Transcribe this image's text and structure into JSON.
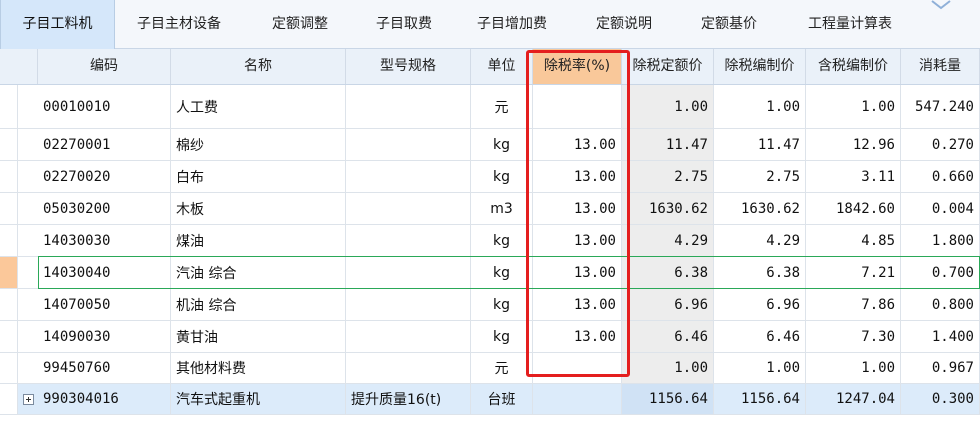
{
  "tabs": [
    {
      "label": "子目工料机",
      "active": true
    },
    {
      "label": "子目主材设备",
      "active": false
    },
    {
      "label": "定额调整",
      "active": false
    },
    {
      "label": "子目取费",
      "active": false
    },
    {
      "label": "子目增加费",
      "active": false
    },
    {
      "label": "定额说明",
      "active": false
    },
    {
      "label": "定额基价",
      "active": false
    },
    {
      "label": "工程量计算表",
      "active": false
    }
  ],
  "columns": {
    "code": "编码",
    "name": "名称",
    "spec": "型号规格",
    "unit": "单位",
    "tax_rate": "除税率(%)",
    "quota_price_ex_tax": "除税定额价",
    "budget_price_ex_tax": "除税编制价",
    "budget_price_in_tax": "含税编制价",
    "consumption": "消耗量"
  },
  "rows": [
    {
      "code": "00010010",
      "name": "人工费",
      "spec": "",
      "unit": "元",
      "tax_rate": "",
      "quota_price_ex_tax": "1.00",
      "budget_price_ex_tax": "1.00",
      "budget_price_in_tax": "1.00",
      "consumption": "547.240"
    },
    {
      "code": "02270001",
      "name": "棉纱",
      "spec": "",
      "unit": "kg",
      "tax_rate": "13.00",
      "quota_price_ex_tax": "11.47",
      "budget_price_ex_tax": "11.47",
      "budget_price_in_tax": "12.96",
      "consumption": "0.270"
    },
    {
      "code": "02270020",
      "name": "白布",
      "spec": "",
      "unit": "kg",
      "tax_rate": "13.00",
      "quota_price_ex_tax": "2.75",
      "budget_price_ex_tax": "2.75",
      "budget_price_in_tax": "3.11",
      "consumption": "0.660"
    },
    {
      "code": "05030200",
      "name": "木板",
      "spec": "",
      "unit": "m3",
      "tax_rate": "13.00",
      "quota_price_ex_tax": "1630.62",
      "budget_price_ex_tax": "1630.62",
      "budget_price_in_tax": "1842.60",
      "consumption": "0.004"
    },
    {
      "code": "14030030",
      "name": "煤油",
      "spec": "",
      "unit": "kg",
      "tax_rate": "13.00",
      "quota_price_ex_tax": "4.29",
      "budget_price_ex_tax": "4.29",
      "budget_price_in_tax": "4.85",
      "consumption": "1.800"
    },
    {
      "code": "14030040",
      "name": "汽油 综合",
      "spec": "",
      "unit": "kg",
      "tax_rate": "13.00",
      "quota_price_ex_tax": "6.38",
      "budget_price_ex_tax": "6.38",
      "budget_price_in_tax": "7.21",
      "consumption": "0.700",
      "selected": true
    },
    {
      "code": "14070050",
      "name": "机油 综合",
      "spec": "",
      "unit": "kg",
      "tax_rate": "13.00",
      "quota_price_ex_tax": "6.96",
      "budget_price_ex_tax": "6.96",
      "budget_price_in_tax": "7.86",
      "consumption": "0.800"
    },
    {
      "code": "14090030",
      "name": "黄甘油",
      "spec": "",
      "unit": "kg",
      "tax_rate": "13.00",
      "quota_price_ex_tax": "6.46",
      "budget_price_ex_tax": "6.46",
      "budget_price_in_tax": "7.30",
      "consumption": "1.400"
    },
    {
      "code": "99450760",
      "name": "其他材料费",
      "spec": "",
      "unit": "元",
      "tax_rate": "",
      "quota_price_ex_tax": "1.00",
      "budget_price_ex_tax": "1.00",
      "budget_price_in_tax": "1.00",
      "consumption": "0.967"
    },
    {
      "code": "990304016",
      "name": "汽车式起重机",
      "spec": "提升质量16(t)",
      "unit": "台班",
      "tax_rate": "",
      "quota_price_ex_tax": "1156.64",
      "budget_price_ex_tax": "1156.64",
      "budget_price_in_tax": "1247.04",
      "consumption": "0.300",
      "expandable": true,
      "highlight": true
    }
  ],
  "colors": {
    "highlight_header": "#f9c89a",
    "annotation_box": "#e41e1e",
    "selection_outline": "#2aa858",
    "active_tab": "#d5e7fa"
  }
}
